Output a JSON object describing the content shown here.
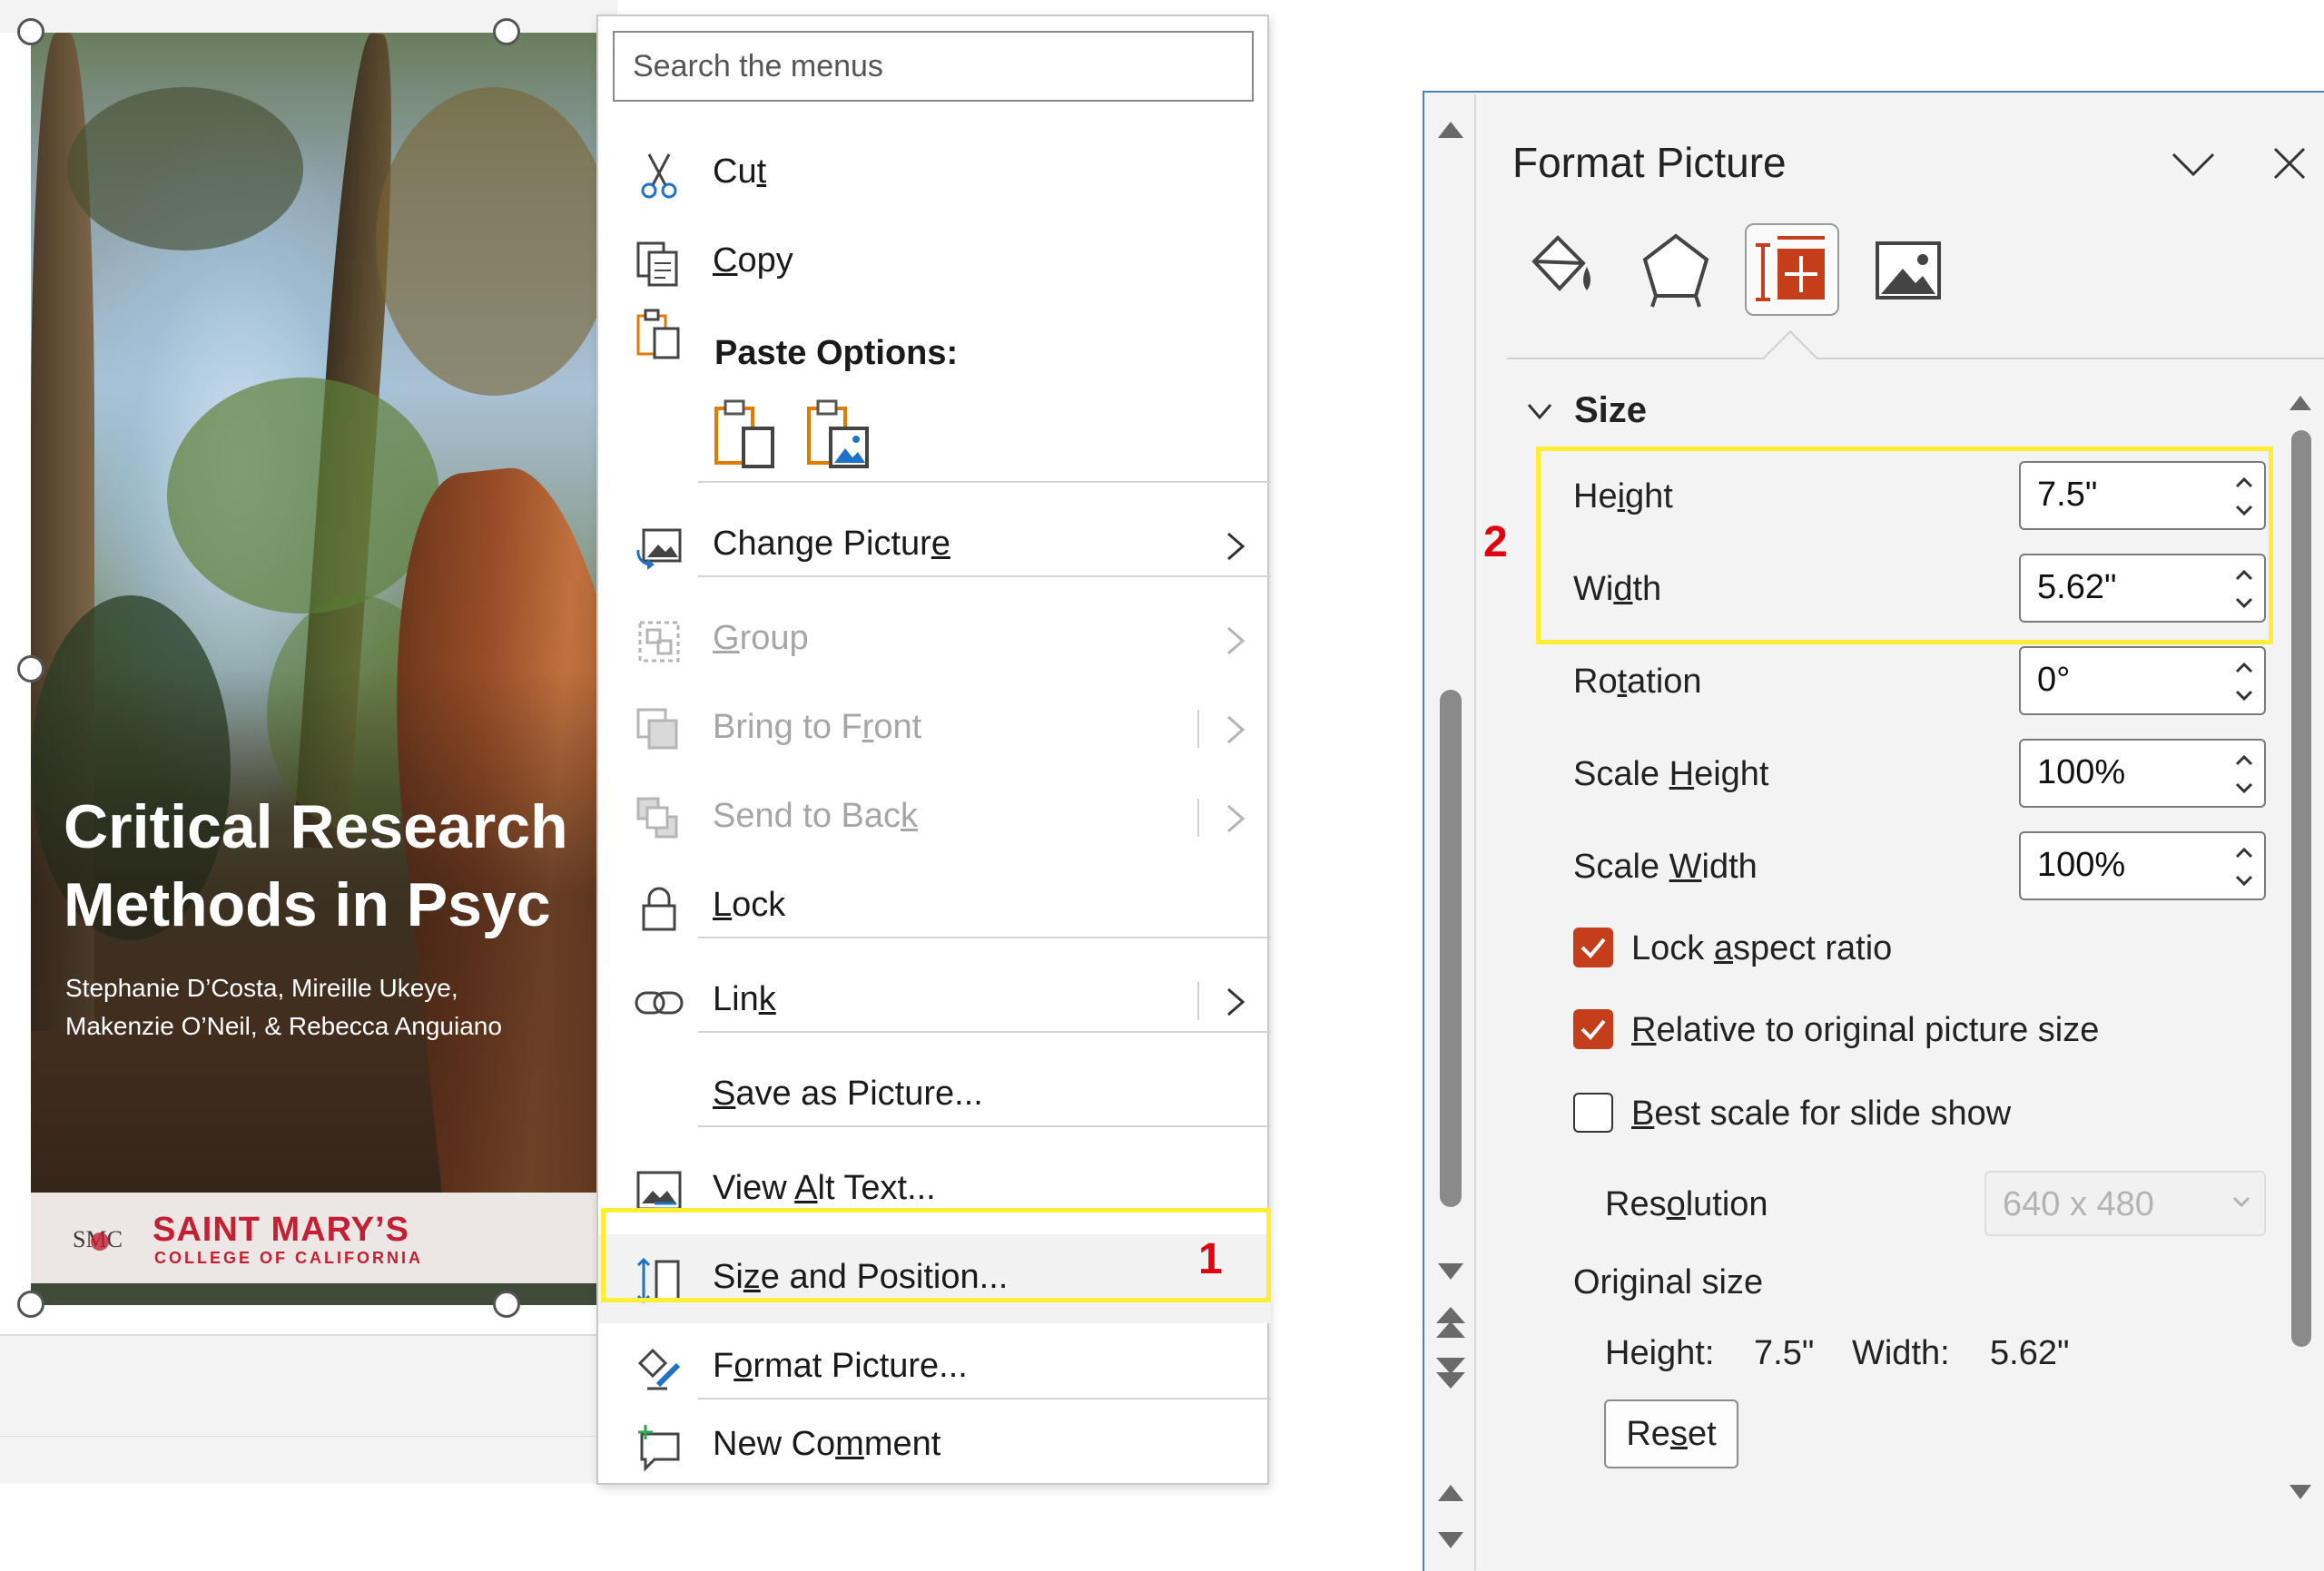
{
  "slide": {
    "title": "Critical Research\nMethods in Psyc",
    "authors": "Stephanie D’Costa, Mireille Ukeye,\nMakenzie O’Neil, & Rebecca Anguiano",
    "logo_text": "SMC",
    "college_name": "SAINT MARY’S",
    "college_sub": "COLLEGE OF CALIFORNIA"
  },
  "context_menu": {
    "search_placeholder": "Search the menus",
    "cut": {
      "pre": "Cu",
      "key": "t",
      "post": ""
    },
    "copy": {
      "pre": "",
      "key": "C",
      "post": "opy"
    },
    "paste_options": "Paste Options:",
    "change_picture": {
      "pre": "Change Pictur",
      "key": "e",
      "post": ""
    },
    "group": {
      "pre": "",
      "key": "G",
      "post": "roup"
    },
    "bring_to_front": {
      "pre": "Bring to F",
      "key": "r",
      "post": "ont"
    },
    "send_to_back": {
      "pre": "Send to Bac",
      "key": "k",
      "post": ""
    },
    "lock": {
      "pre": "",
      "key": "L",
      "post": "ock"
    },
    "link": {
      "pre": "Lin",
      "key": "k",
      "post": ""
    },
    "save_as_picture": {
      "pre": "",
      "key": "S",
      "post": "ave as Picture..."
    },
    "view_alt_text": {
      "pre": "View ",
      "key": "A",
      "post": "lt Text..."
    },
    "size_and_position": {
      "pre": "Si",
      "key": "z",
      "post": "e and Position..."
    },
    "format_picture": {
      "pre": "F",
      "key": "o",
      "post": "rmat Picture..."
    },
    "new_comment": {
      "pre": "New Co",
      "key": "m",
      "post": "ment"
    }
  },
  "annotations": {
    "step1": "1",
    "step2": "2",
    "highlight_color": "#ffee33",
    "badge_color": "#e0000f"
  },
  "format_pane": {
    "title": "Format Picture",
    "tabs": [
      "fill-line-icon",
      "effects-icon",
      "size-properties-icon",
      "picture-icon"
    ],
    "active_tab": "size-properties-icon",
    "section": "Size",
    "height": {
      "pre": "He",
      "key": "i",
      "post": "ght",
      "value": "7.5\""
    },
    "width": {
      "pre": "Wi",
      "key": "d",
      "post": "th",
      "value": "5.62\""
    },
    "rotation": {
      "pre": "Ro",
      "key": "t",
      "post": "ation",
      "value": "0°"
    },
    "scale_height": {
      "pre": "Scale ",
      "key": "H",
      "post": "eight",
      "value": "100%"
    },
    "scale_width": {
      "pre": "Scale ",
      "key": "W",
      "post": "idth",
      "value": "100%"
    },
    "lock_aspect": {
      "pre": "Lock ",
      "key": "a",
      "post": "spect ratio",
      "checked": true
    },
    "relative_original": {
      "pre": "",
      "key": "R",
      "post": "elative to original picture size",
      "checked": true
    },
    "best_scale": {
      "pre": "",
      "key": "B",
      "post": "est scale for slide show",
      "checked": false
    },
    "resolution": {
      "pre": "Res",
      "key": "o",
      "post": "lution",
      "value": "640 x 480"
    },
    "original_size_label": "Original size",
    "original_height_label": "Height:",
    "original_height": "7.5\"",
    "original_width_label": "Width:",
    "original_width": "5.62\"",
    "reset": {
      "pre": "Re",
      "key": "s",
      "post": "et"
    },
    "accent_color": "#c43e1c"
  }
}
